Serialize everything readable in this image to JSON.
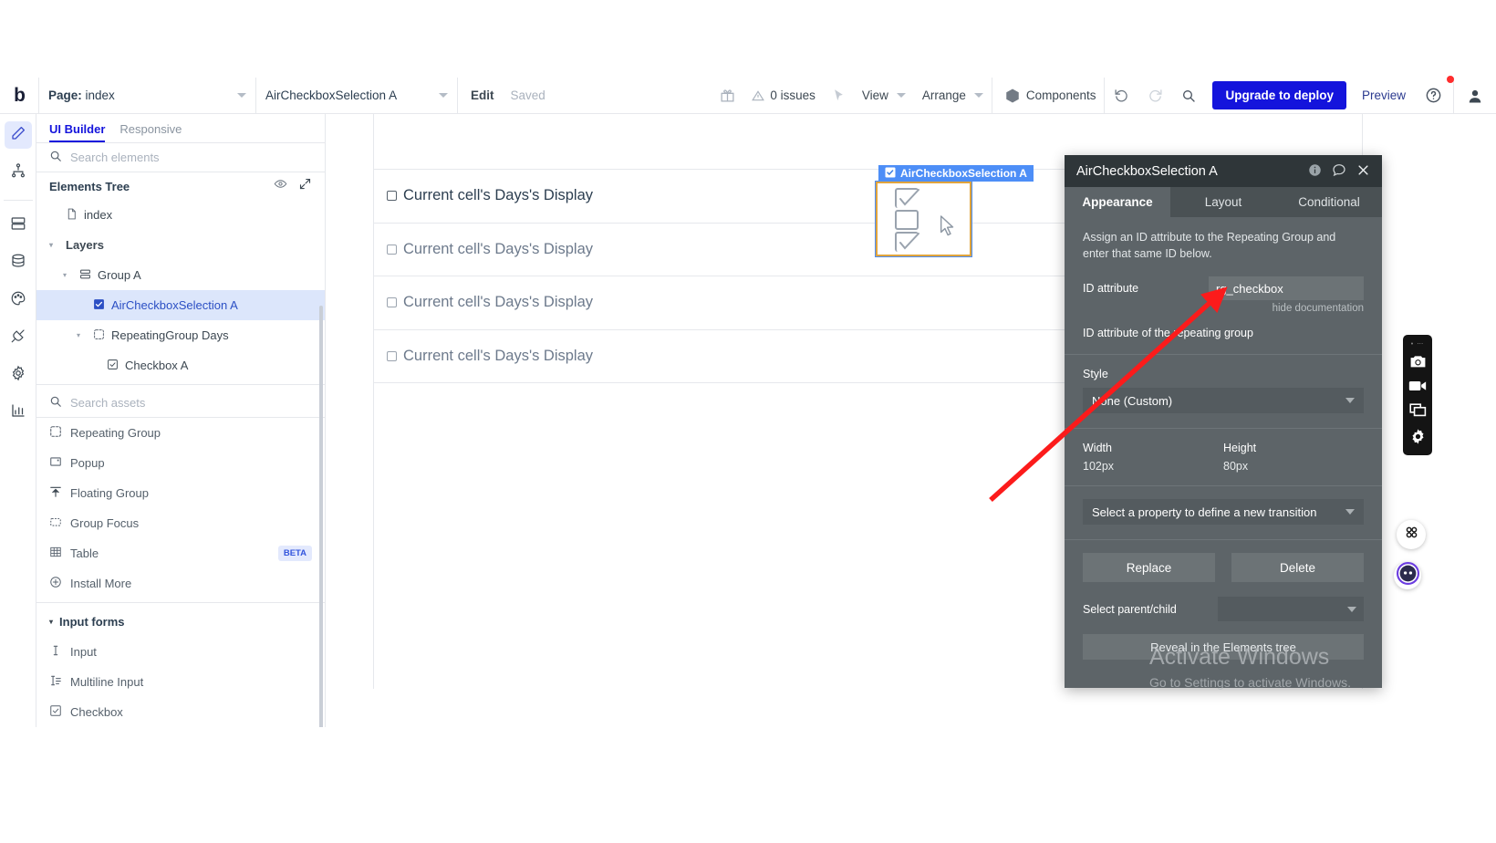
{
  "topbar": {
    "logo": "b",
    "page_select": {
      "prefix": "Page:",
      "value": "index"
    },
    "element_select": {
      "value": "AirCheckboxSelection A"
    },
    "edit_label": "Edit",
    "saved_label": "Saved",
    "gift_icon": "gift-icon",
    "issues_label": "0 issues",
    "pointer_icon": "pointer-icon",
    "view_label": "View",
    "arrange_label": "Arrange",
    "components_label": "Components",
    "undo_icon": "undo-icon",
    "redo_icon": "redo-icon",
    "search_icon": "search-icon",
    "deploy_label": "Upgrade to deploy",
    "preview_label": "Preview",
    "help_icon": "help-icon",
    "account_icon": "account-avatar-icon",
    "deploy_color": "#1414dc"
  },
  "rail": {
    "items": [
      {
        "icon": "pencil-design-icon",
        "active": true
      },
      {
        "icon": "workflow-icon",
        "active": false
      },
      {
        "icon": "data-layers-icon",
        "active": false
      },
      {
        "icon": "database-icon",
        "active": false
      },
      {
        "icon": "styles-palette-icon",
        "active": false
      },
      {
        "icon": "plugins-plug-icon",
        "active": false
      },
      {
        "icon": "settings-gear-icon",
        "active": false
      },
      {
        "icon": "logs-chart-icon",
        "active": false
      }
    ]
  },
  "left_panel": {
    "tabs": [
      {
        "label": "UI Builder",
        "active": true
      },
      {
        "label": "Responsive",
        "active": false
      }
    ],
    "search_elements_placeholder": "Search elements",
    "elements_tree": {
      "title": "Elements Tree",
      "eye_icon": "eye-icon",
      "expand_icon": "expand-icon",
      "nodes": [
        {
          "label": "index",
          "icon": "page-file-icon",
          "indent": 0,
          "twisty": "",
          "selected": false,
          "bold": false
        },
        {
          "label": "Layers",
          "icon": "",
          "indent": 0,
          "twisty": "▾",
          "selected": false,
          "bold": true
        },
        {
          "label": "Group A",
          "icon": "group-icon",
          "indent": 1,
          "twisty": "▾",
          "selected": false,
          "bold": false
        },
        {
          "label": "AirCheckboxSelection A",
          "icon": "checkbox-filled-icon",
          "indent": 2,
          "twisty": "",
          "selected": true,
          "bold": false
        },
        {
          "label": "RepeatingGroup Days",
          "icon": "repeating-group-icon",
          "indent": 2,
          "twisty": "▾",
          "selected": false,
          "bold": false
        },
        {
          "label": "Checkbox A",
          "icon": "checkbox-icon",
          "indent": 3,
          "twisty": "",
          "selected": false,
          "bold": false
        }
      ]
    },
    "search_assets_placeholder": "Search assets",
    "asset_items": [
      {
        "label": "Repeating Group",
        "icon": "repeating-group-icon",
        "badge": ""
      },
      {
        "label": "Popup",
        "icon": "popup-icon",
        "badge": ""
      },
      {
        "label": "Floating Group",
        "icon": "floating-group-icon",
        "badge": ""
      },
      {
        "label": "Group Focus",
        "icon": "group-focus-icon",
        "badge": ""
      },
      {
        "label": "Table",
        "icon": "table-icon",
        "badge": "BETA"
      },
      {
        "label": "Install More",
        "icon": "plus-circle-icon",
        "badge": ""
      }
    ],
    "input_forms": {
      "title": "Input forms",
      "twisty": "▾",
      "items": [
        {
          "label": "Input",
          "icon": "text-input-icon"
        },
        {
          "label": "Multiline Input",
          "icon": "multiline-input-icon"
        },
        {
          "label": "Checkbox",
          "icon": "checkbox-icon"
        }
      ]
    }
  },
  "canvas": {
    "selected_badge": {
      "label": "AirCheckboxSelection A",
      "icon": "checkbox-filled-icon",
      "color": "#4d8ef7"
    },
    "selection_border_color": "#e0a43c",
    "repeating_group_rows": [
      {
        "text": "Current cell's Days's Display"
      },
      {
        "text": "Current cell's Days's Display"
      },
      {
        "text": "Current cell's Days's Display"
      },
      {
        "text": "Current cell's Days's Display"
      }
    ]
  },
  "property_panel": {
    "title": "AirCheckboxSelection A",
    "header_icons": [
      "info-icon",
      "comment-icon",
      "close-icon"
    ],
    "tabs": [
      {
        "label": "Appearance",
        "active": true
      },
      {
        "label": "Layout",
        "active": false
      },
      {
        "label": "Conditional",
        "active": false
      }
    ],
    "note": "Assign an ID attribute to the Repeating Group and enter that same ID below.",
    "id_attribute_label": "ID attribute",
    "id_attribute_value": "rg_checkbox",
    "hide_documentation": "hide documentation",
    "id_attribute_help": "ID attribute of the repeating group",
    "style_label": "Style",
    "style_value": "None (Custom)",
    "width_label": "Width",
    "width_value": "102px",
    "height_label": "Height",
    "height_value": "80px",
    "transition_placeholder": "Select a property to define a new transition",
    "replace_label": "Replace",
    "delete_label": "Delete",
    "select_parent_child_label": "Select parent/child",
    "reveal_label": "Reveal in the Elements tree"
  },
  "watermark": {
    "title": "Activate Windows",
    "subtitle": "Go to Settings to activate Windows."
  },
  "right_tools": {
    "dots": "• ⋯",
    "items": [
      "camera-icon",
      "video-camera-icon",
      "window-capture-icon",
      "settings-gear-icon"
    ],
    "grid_fab": "grid-apps-icon",
    "assistant_fab": "assistant-avatar-icon"
  }
}
